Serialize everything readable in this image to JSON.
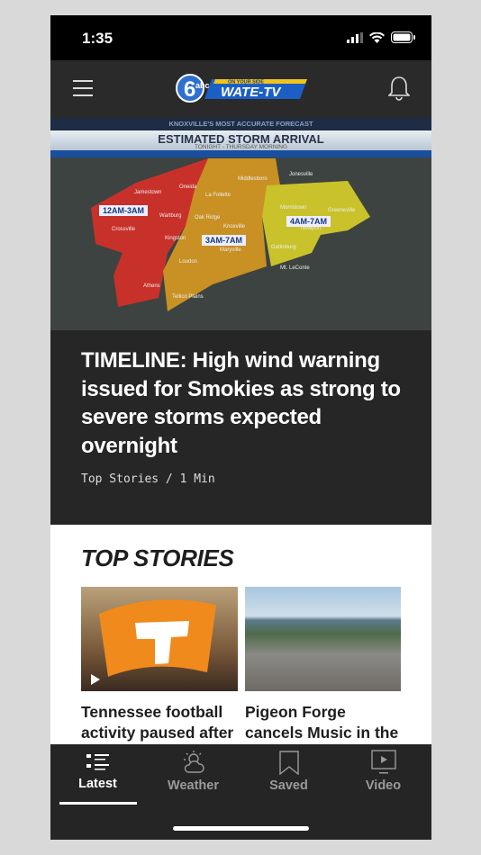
{
  "status_bar": {
    "time": "1:35"
  },
  "app_bar": {
    "logo_text": "WATE-TV",
    "logo_channel": "6",
    "logo_tagline": "ON YOUR SIDE"
  },
  "hero": {
    "image": {
      "banner_top": "KNOXVILLE'S MOST ACCURATE FORECAST",
      "banner_title": "ESTIMATED STORM ARRIVAL",
      "banner_sub": "TONIGHT - THURSDAY MORNING",
      "zones": [
        {
          "label": "12AM-3AM",
          "color": "#c8312a"
        },
        {
          "label": "3AM-7AM",
          "color": "#c99024"
        },
        {
          "label": "4AM-7AM",
          "color": "#c9c22a"
        }
      ],
      "towns": [
        "Jamestown",
        "Oneida",
        "Middlesboro",
        "Jonesville",
        "La Follette",
        "Wartburg",
        "Oak Ridge",
        "Crossville",
        "Knoxville",
        "Morristown",
        "Greeneville",
        "Newport",
        "Kingston",
        "Maryville",
        "Gatlinburg",
        "Loudon",
        "Mt. LeConte",
        "Athens",
        "Tellico Plains"
      ]
    },
    "title": "TIMELINE: High wind warning issued for Smokies as strong to severe storms expected overnight",
    "meta": "Top Stories / 1 Min"
  },
  "top_stories": {
    "title": "TOP STORIES",
    "cards": [
      {
        "title": "Tennessee football activity paused after"
      },
      {
        "title": "Pigeon Forge cancels Music in the"
      }
    ]
  },
  "tabs": [
    {
      "label": "Latest",
      "icon": "list-icon",
      "active": true
    },
    {
      "label": "Weather",
      "icon": "partly-cloudy-icon"
    },
    {
      "label": "Saved",
      "icon": "bookmark-icon"
    },
    {
      "label": "Video",
      "icon": "video-play-icon"
    }
  ]
}
